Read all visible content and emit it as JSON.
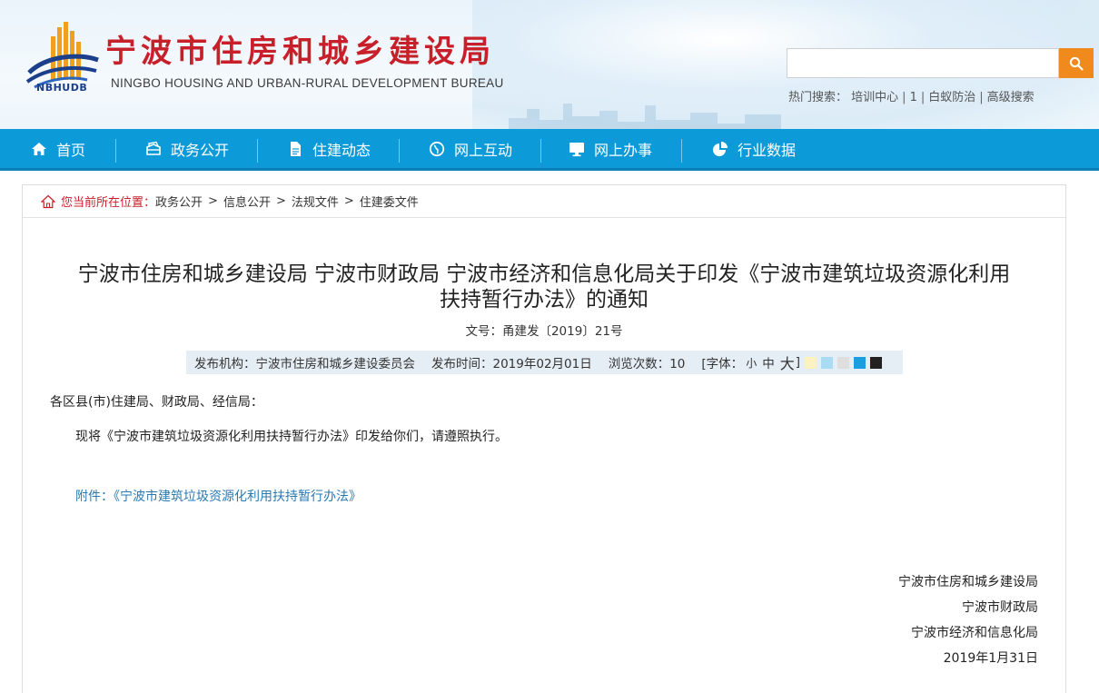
{
  "header": {
    "org_name_cn": "宁波市住房和城乡建设局",
    "org_name_en": "NINGBO HOUSING AND URBAN-RURAL DEVELOPMENT BUREAU",
    "logo_abbr": "NBHUDB",
    "search": {
      "placeholder": "",
      "button_icon": "search-icon"
    },
    "hot_search": {
      "label": "热门搜索：",
      "items": [
        "培训中心",
        "1",
        "白蚁防治",
        "高级搜索"
      ]
    }
  },
  "nav": {
    "items": [
      {
        "label": "首页",
        "icon": "home-icon"
      },
      {
        "label": "政务公开",
        "icon": "open-box-icon"
      },
      {
        "label": "住建动态",
        "icon": "document-icon"
      },
      {
        "label": "网上互动",
        "icon": "globe-icon"
      },
      {
        "label": "网上办事",
        "icon": "monitor-icon"
      },
      {
        "label": "行业数据",
        "icon": "pie-chart-icon"
      }
    ]
  },
  "breadcrumb": {
    "label": "您当前所在位置：",
    "items": [
      "政务公开",
      "信息公开",
      "法规文件",
      "住建委文件"
    ],
    "separator": ">"
  },
  "article": {
    "title_line1": "宁波市住房和城乡建设局 宁波市财政局 宁波市经济和信息化局关于印发《宁波市建筑垃圾资源化利用",
    "title_line2": "扶持暂行办法》的通知",
    "doc_number": "文号：甬建发〔2019〕21号",
    "meta": {
      "publisher": "发布机构：宁波市住房和城乡建设委员会",
      "publish_time": "发布时间：2019年02月01日",
      "views": "浏览次数：10",
      "font_label": "[字体：",
      "font_small": "小",
      "font_medium": "中",
      "font_large": "大",
      "font_close": "]",
      "swatches": [
        "#fbf2c0",
        "#a9dcf3",
        "#dedede",
        "#1b9ee0",
        "#222222"
      ]
    },
    "addressee": "各区县(市)住建局、财政局、经信局：",
    "body": "现将《宁波市建筑垃圾资源化利用扶持暂行办法》印发给你们，请遵照执行。",
    "attachment": "附件：《宁波市建筑垃圾资源化利用扶持暂行办法》",
    "signatures": [
      "宁波市住房和城乡建设局",
      "宁波市财政局",
      "宁波市经济和信息化局"
    ],
    "sign_date": "2019年1月31日"
  },
  "colors": {
    "brand_red": "#c8202a",
    "nav_blue": "#0c9ad9",
    "search_orange": "#f08a1c",
    "link_blue": "#2a7ab0"
  }
}
